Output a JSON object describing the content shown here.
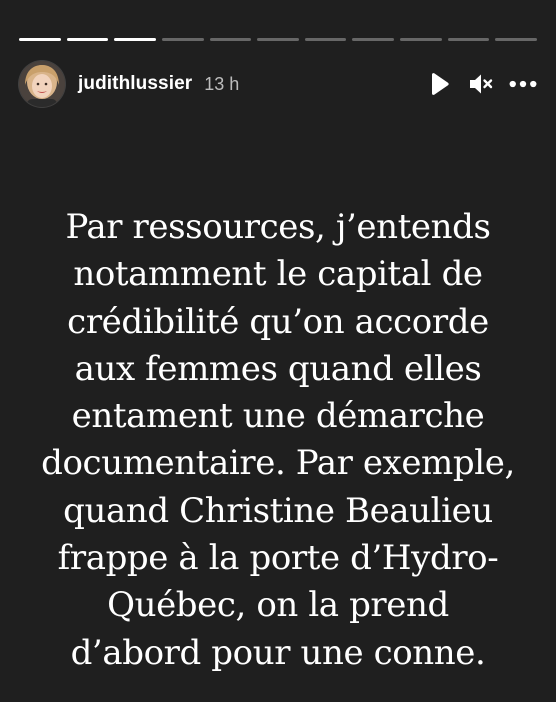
{
  "story": {
    "progress": {
      "total_segments": 11,
      "completed_segments": 3
    },
    "header": {
      "username": "judithlussier",
      "timestamp": "13 h"
    },
    "controls": {
      "play_icon": "play-icon",
      "mute_icon": "volume-muted-icon",
      "more_icon": "more-options-icon"
    },
    "text_lines": [
      "Par ressources, j’entends",
      "notamment le capital de",
      "crédibilité qu’on accorde",
      "aux femmes quand elles",
      "entament une démarche",
      "documentaire. Par exemple,",
      "quand Christine Beaulieu",
      "frappe à la porte d’Hydro-",
      "Québec, on la prend",
      "d’abord pour une conne."
    ],
    "colors": {
      "background": "#1f1f1f",
      "text": "#ffffff",
      "progress_done": "#ffffff",
      "progress_pending": "rgba(255,255,255,0.32)"
    }
  }
}
